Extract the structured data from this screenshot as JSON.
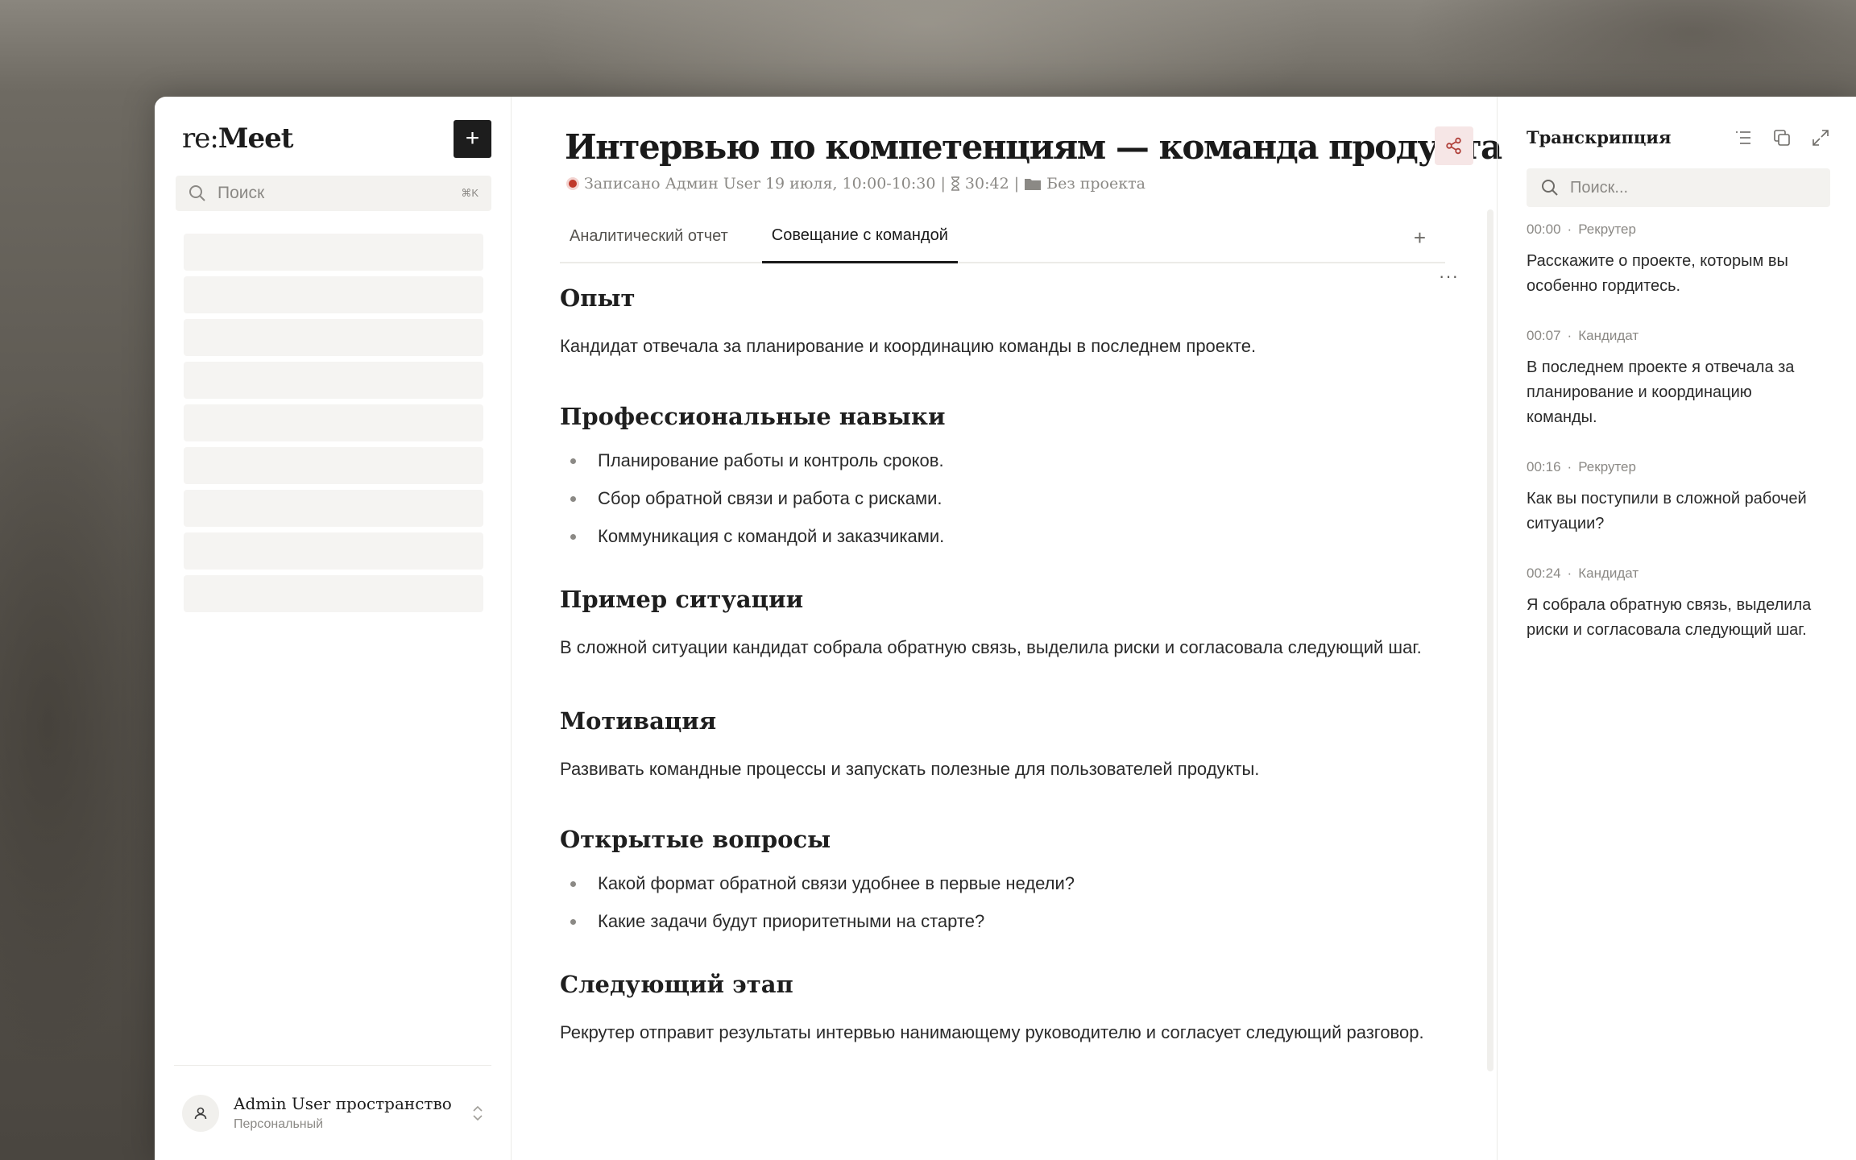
{
  "sidebar": {
    "logo_prefix": "re:",
    "logo_name": "Meet",
    "new_label": "+",
    "search_placeholder": "Поиск",
    "search_shortcut": "⌘K",
    "workspace": {
      "name": "Admin User пространство",
      "type": "Персональный"
    }
  },
  "main": {
    "title": "Интервью по компетенциям — команда продукта",
    "meta": {
      "recorded": "Записано Админ User 19 июля, 10:00-10:30 |",
      "duration": "30:42 |",
      "project": "Без проекта"
    },
    "more_label": "···",
    "tabs": [
      {
        "label": "Аналитический отчет"
      },
      {
        "label": "Совещание с командой"
      }
    ],
    "tab_add_label": "+",
    "sections": [
      {
        "heading": "Опыт",
        "text": "Кандидат отвечала за планирование и координацию команды в последнем проекте."
      },
      {
        "heading": "Профессиональные навыки",
        "bullets": [
          "Планирование работы и контроль сроков.",
          "Сбор обратной связи и работа с рисками.",
          "Коммуникация с командой и заказчиками."
        ]
      },
      {
        "heading": "Пример ситуации",
        "text": "В сложной ситуации кандидат собрала обратную связь, выделила риски и согласовала следующий шаг."
      },
      {
        "heading": "Мотивация",
        "text": "Развивать командные процессы и запускать полезные для пользователей продукты."
      },
      {
        "heading": "Открытые вопросы",
        "bullets": [
          "Какой формат обратной связи удобнее в первые недели?",
          "Какие задачи будут приоритетными на старте?"
        ]
      },
      {
        "heading": "Следующий этап",
        "text": "Рекрутер отправит результаты интервью нанимающему руководителю и согласует следующий разговор."
      }
    ]
  },
  "transcript": {
    "title": "Транскрипция",
    "search_placeholder": "Поиск...",
    "entries": [
      {
        "time": "00:00",
        "speaker": "Рекрутер",
        "text": "Расскажите о проекте, которым вы особенно гордитесь."
      },
      {
        "time": "00:07",
        "speaker": "Кандидат",
        "text": "В последнем проекте я отвечала за планирование и координацию команды."
      },
      {
        "time": "00:16",
        "speaker": "Рекрутер",
        "text": "Как вы поступили в сложной рабочей ситуации?"
      },
      {
        "time": "00:24",
        "speaker": "Кандидат",
        "text": "Я собрала обратную связь, выделила риски и согласовала следующий шаг."
      }
    ]
  },
  "colors": {
    "accent_red": "#c0392b",
    "share_bg": "#f6e6e6",
    "dark": "#1d1d1d"
  }
}
